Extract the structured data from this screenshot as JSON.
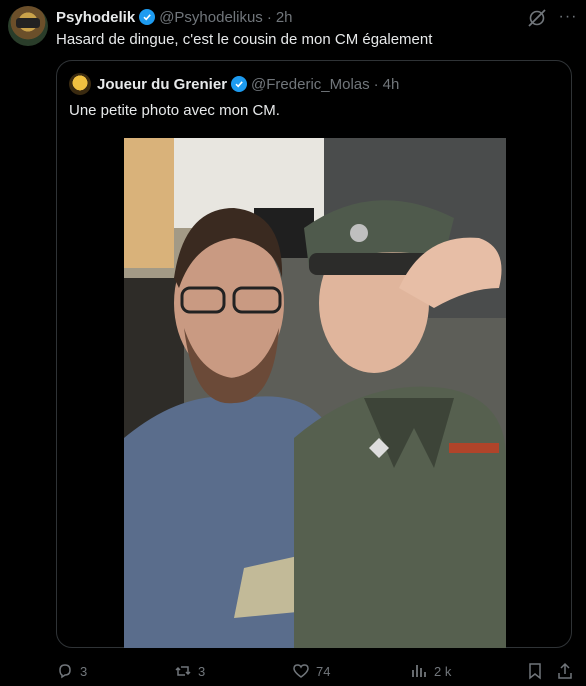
{
  "post": {
    "author_name": "Psyhodelik",
    "handle": "@Psyhodelikus",
    "separator": "·",
    "time": "2h",
    "text": "Hasard de dingue, c'est le cousin de mon CM également"
  },
  "quote": {
    "author_name": "Joueur du Grenier",
    "handle": "@Frederic_Molas",
    "separator": "·",
    "time": "4h",
    "text": "Une petite photo avec mon CM."
  },
  "actions": {
    "replies": "3",
    "reposts": "3",
    "likes": "74",
    "views": "2 k"
  },
  "icons": [
    "verified-badge-icon",
    "grok-icon",
    "more-icon",
    "reply-icon",
    "repost-icon",
    "like-icon",
    "views-icon",
    "bookmark-icon",
    "share-icon"
  ],
  "colors": {
    "background": "#000000",
    "text": "#e7e9ea",
    "muted": "#71767b",
    "verified": "#1d9bf0",
    "border": "#2f3336"
  }
}
